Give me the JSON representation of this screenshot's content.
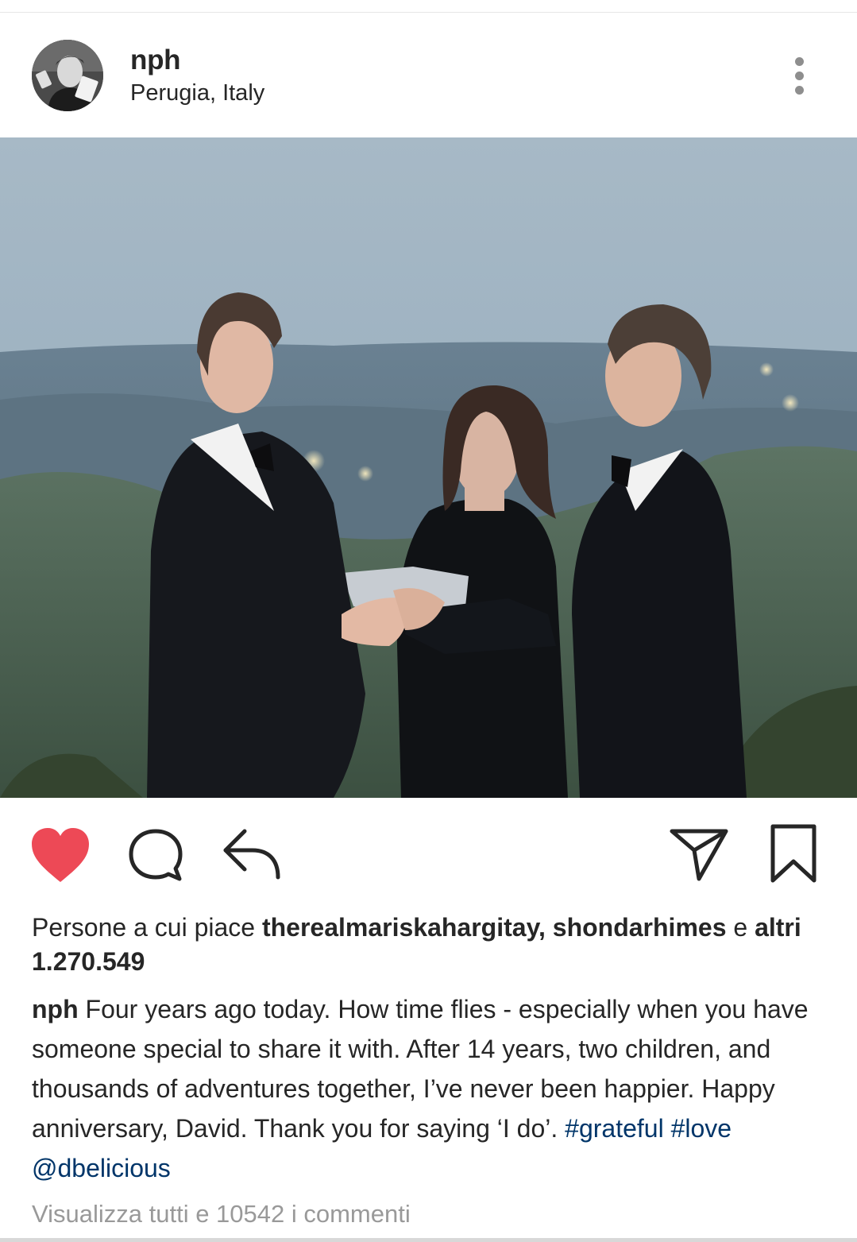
{
  "post": {
    "username": "nph",
    "location": "Perugia, Italy"
  },
  "icons": {
    "avatar": "profile-photo",
    "more": "more-vertical-icon",
    "like": "heart-filled-icon",
    "comment": "comment-bubble-icon",
    "reply": "reply-arrow-icon",
    "send": "send-paper-plane-icon",
    "save": "bookmark-icon"
  },
  "colors": {
    "like_active": "#ed4956",
    "link": "#003569",
    "muted": "#999999",
    "text": "#262626"
  },
  "likes": {
    "prefix": "Persone a cui piace ",
    "user1": "therealmariskahargitay",
    "separator": ", ",
    "user2": "shondarhimes",
    "conjunction": " e ",
    "others": "altri 1.270.549"
  },
  "caption": {
    "username": "nph",
    "text": " Four years ago today. How time flies - especially when you have someone special to share it with. After 14 years, two children, and thousands of adventures together, I’ve never been happier. Happy anniversary, David. Thank you for saying ‘I do’. ",
    "tag1": "#grateful",
    "space": " ",
    "tag2": "#love",
    "mention": "@dbelicious"
  },
  "comments_link": "Visualizza tutti e 10542 i commenti"
}
